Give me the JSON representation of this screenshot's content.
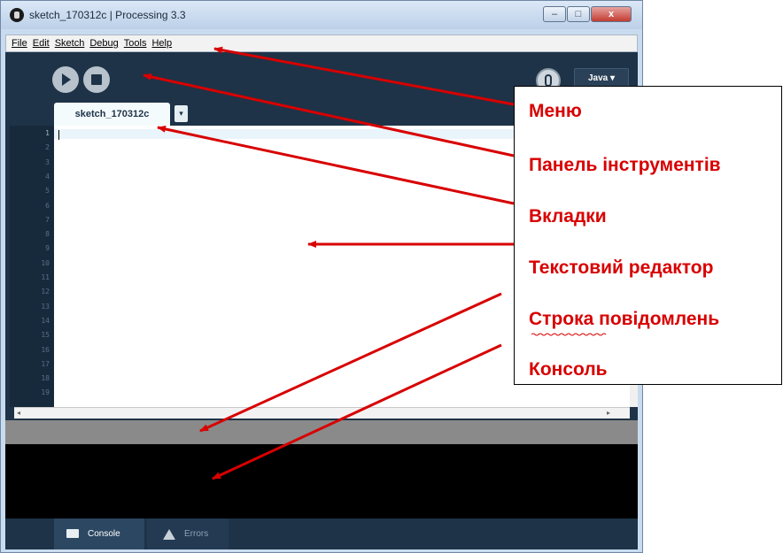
{
  "window": {
    "title": "sketch_170312c | Processing 3.3",
    "controls": {
      "minimize": "–",
      "maximize": "□",
      "close": "x"
    }
  },
  "menu": [
    "File",
    "Edit",
    "Sketch",
    "Debug",
    "Tools",
    "Help"
  ],
  "toolbar": {
    "run_icon": "play-icon",
    "stop_icon": "stop-icon",
    "debug_icon": "debugger-icon",
    "mode": "Java ▾"
  },
  "tabs": {
    "active": "sketch_170312c",
    "menu_arrow": "▾"
  },
  "editor": {
    "line_numbers": [
      "1",
      "2",
      "3",
      "4",
      "5",
      "6",
      "7",
      "8",
      "9",
      "10",
      "11",
      "12",
      "13",
      "14",
      "15",
      "16",
      "17",
      "18",
      "19"
    ]
  },
  "footer": {
    "console_tab": "Console",
    "errors_tab": "Errors"
  },
  "annotations": {
    "labels": [
      "Меню",
      "Панель інструментів",
      "Вкладки",
      "Текстовий редактор",
      "Строка повідомлень",
      "Консоль"
    ],
    "color": "#d80000"
  },
  "colors": {
    "editor_bg": "#1e3347",
    "message_bar": "#8a8a8a",
    "console_bg": "#000000"
  }
}
